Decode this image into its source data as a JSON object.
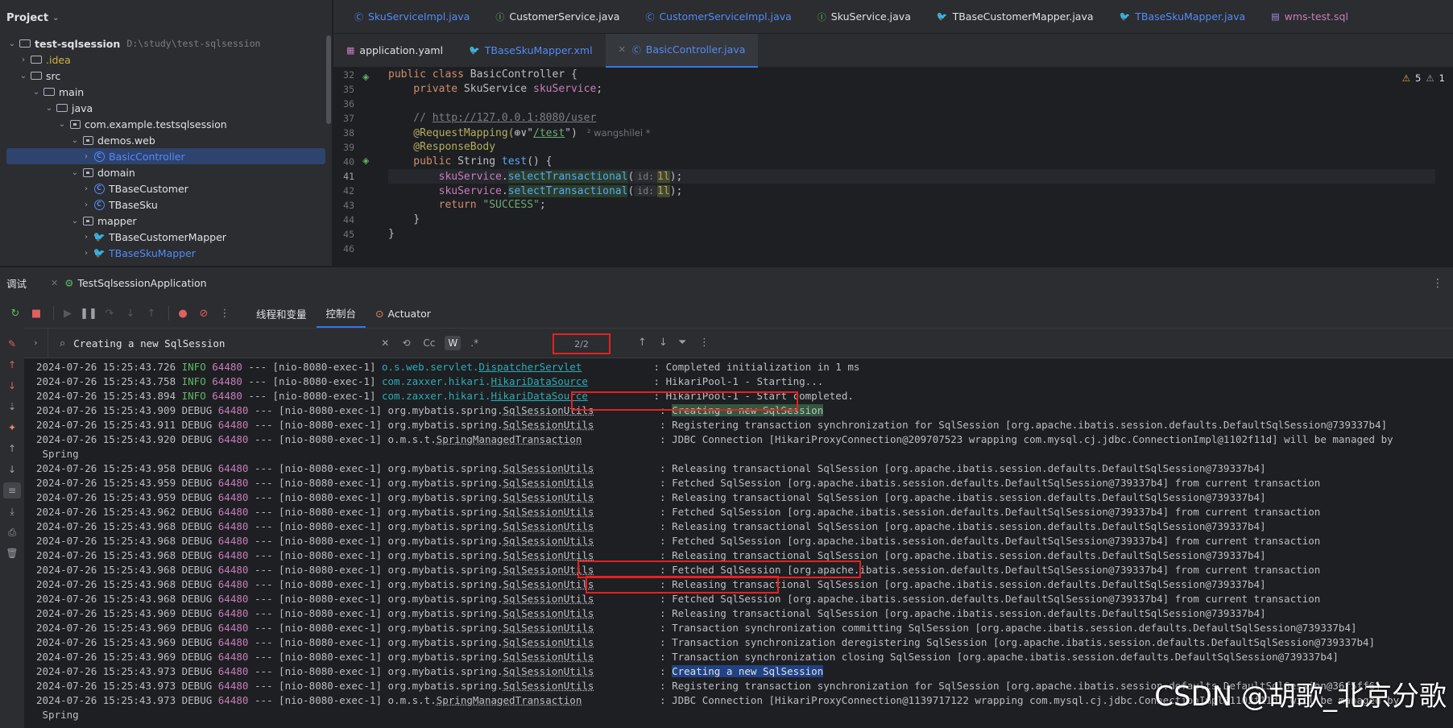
{
  "project": {
    "title": "Project",
    "tree": [
      {
        "label": "test-sqlsession",
        "path": "D:\\study\\test-sqlsession",
        "kind": "module"
      },
      {
        "label": ".idea",
        "kind": "folder"
      },
      {
        "label": "src",
        "kind": "folder"
      },
      {
        "label": "main",
        "kind": "folder"
      },
      {
        "label": "java",
        "kind": "folder"
      },
      {
        "label": "com.example.testsqlsession",
        "kind": "package"
      },
      {
        "label": "demos.web",
        "kind": "package"
      },
      {
        "label": "BasicController",
        "kind": "class"
      },
      {
        "label": "domain",
        "kind": "package"
      },
      {
        "label": "TBaseCustomer",
        "kind": "class"
      },
      {
        "label": "TBaseSku",
        "kind": "class"
      },
      {
        "label": "mapper",
        "kind": "package"
      },
      {
        "label": "TBaseCustomerMapper",
        "kind": "mapper"
      },
      {
        "label": "TBaseSkuMapper",
        "kind": "mapper"
      }
    ]
  },
  "editor": {
    "tabs_row1": [
      {
        "label": "SkuServiceImpl.java",
        "icon": "class-icon"
      },
      {
        "label": "CustomerService.java",
        "icon": "interface-icon"
      },
      {
        "label": "CustomerServiceImpl.java",
        "icon": "class-icon"
      },
      {
        "label": "SkuService.java",
        "icon": "interface-icon"
      },
      {
        "label": "TBaseCustomerMapper.java",
        "icon": "mapper-icon"
      },
      {
        "label": "TBaseSkuMapper.java",
        "icon": "mapper-icon"
      },
      {
        "label": "wms-test.sql",
        "icon": "sql-icon"
      }
    ],
    "tabs_row2": [
      {
        "label": "application.yaml",
        "icon": "yaml-icon"
      },
      {
        "label": "TBaseSkuMapper.xml",
        "icon": "xml-icon"
      },
      {
        "label": "BasicController.java",
        "icon": "class-icon",
        "active": true
      }
    ],
    "line_numbers": [
      "32",
      "35",
      "36",
      "37",
      "38",
      "39",
      "40",
      "41",
      "42",
      "43",
      "44",
      "45",
      "46"
    ],
    "code": {
      "l32_a": "public class ",
      "l32_b": "BasicController {",
      "l35_a": "    private ",
      "l35_b": "SkuService ",
      "l35_c": "skuService",
      "l37_a": "    // ",
      "l37_b": "http://127.0.0.1:8080/user",
      "l38_a": "    @RequestMapping(",
      "l38_b": "⊕∨\"",
      "l38_c": "/test",
      "l38_d": "\")",
      "l38_author": "² wangshilei *",
      "l39": "    @ResponseBody",
      "l40_a": "    public ",
      "l40_b": "String ",
      "l40_c": "test",
      "l40_d": "() {",
      "l41_a": "        skuService",
      "l41_b": ".",
      "l41_c": "selectTransactional",
      "l41_d": "(",
      "l41_hint": "id:",
      "l41_e": "1l",
      "l41_f": ");",
      "l42_a": "        skuService",
      "l42_b": ".",
      "l42_c": "selectTransactional",
      "l42_d": "(",
      "l42_hint": "id:",
      "l42_e": "1l",
      "l42_f": ");",
      "l43_a": "        return ",
      "l43_b": "\"SUCCESS\"",
      "l43_c": ";",
      "l44": "    }",
      "l45": "}"
    },
    "warnings": {
      "warn": "5",
      "weak": "1"
    }
  },
  "debug": {
    "title": "调试",
    "config": "TestSqlsessionApplication",
    "tabs": [
      "线程和变量",
      "控制台",
      "Actuator"
    ],
    "search": {
      "value": "Creating a new SqlSession",
      "case_label": "Cc",
      "word_label": "W",
      "regex_label": ".*",
      "count": "2/2"
    }
  },
  "console": {
    "lines": [
      {
        "ts": "2024-07-26 15:25:43.726",
        "lvl": " INFO",
        "pid": "64480",
        "thr": " --- [nio-8080-exec-1] ",
        "lgr_pre": "o.s.web.servlet.",
        "lgr_u": "DispatcherServlet",
        "lgr_post": "",
        "msg": " : Completed initialization in 1 ms",
        "type": "info"
      },
      {
        "ts": "2024-07-26 15:25:43.758",
        "lvl": " INFO",
        "pid": "64480",
        "thr": " --- [nio-8080-exec-1] ",
        "lgr_pre": "com.zaxxer.hikari.",
        "lgr_u": "HikariDataSource",
        "lgr_post": "",
        "msg": " : HikariPool-1 - Starting...",
        "type": "info"
      },
      {
        "ts": "2024-07-26 15:25:43.894",
        "lvl": " INFO",
        "pid": "64480",
        "thr": " --- [nio-8080-exec-1] ",
        "lgr_pre": "com.zaxxer.hikari.",
        "lgr_u": "HikariDataSource",
        "lgr_post": "",
        "msg": " : HikariPool-1 - Start completed.",
        "type": "info"
      },
      {
        "ts": "2024-07-26 15:25:43.909",
        "lvl": " DEBUG",
        "pid": "64480",
        "thr": " --- [nio-8080-exec-1] ",
        "lgr_pre": "org.mybatis.spring.",
        "lgr_u": "SqlSessionUtils",
        "lgr_post": "",
        "msg_pre": " : ",
        "msg_hl": "Creating a new SqlSession",
        "msg_post": "",
        "hl": "other",
        "type": "debug"
      },
      {
        "ts": "2024-07-26 15:25:43.911",
        "lvl": " DEBUG",
        "pid": "64480",
        "thr": " --- [nio-8080-exec-1] ",
        "lgr_pre": "org.mybatis.spring.",
        "lgr_u": "SqlSessionUtils",
        "lgr_post": "",
        "msg": " : Registering transaction synchronization for SqlSession [org.apache.ibatis.session.defaults.DefaultSqlSession@739337b4]",
        "type": "debug"
      },
      {
        "ts": "2024-07-26 15:25:43.920",
        "lvl": " DEBUG",
        "pid": "64480",
        "thr": " --- [nio-8080-exec-1] ",
        "lgr_pre": "o.m.s.t.",
        "lgr_u": "SpringManagedTransaction",
        "lgr_post": "",
        "msg": " : JDBC Connection [HikariProxyConnection@209707523 wrapping com.mysql.cj.jdbc.ConnectionImpl@1102f11d] will be managed by",
        "type": "debug"
      },
      {
        "cont": " Spring"
      },
      {
        "ts": "2024-07-26 15:25:43.958",
        "lvl": " DEBUG",
        "pid": "64480",
        "thr": " --- [nio-8080-exec-1] ",
        "lgr_pre": "org.mybatis.spring.",
        "lgr_u": "SqlSessionUtils",
        "lgr_post": "",
        "msg": " : Releasing transactional SqlSession [org.apache.ibatis.session.defaults.DefaultSqlSession@739337b4]",
        "type": "debug"
      },
      {
        "ts": "2024-07-26 15:25:43.959",
        "lvl": " DEBUG",
        "pid": "64480",
        "thr": " --- [nio-8080-exec-1] ",
        "lgr_pre": "org.mybatis.spring.",
        "lgr_u": "SqlSessionUtils",
        "lgr_post": "",
        "msg": " : Fetched SqlSession [org.apache.ibatis.session.defaults.DefaultSqlSession@739337b4] from current transaction",
        "type": "debug"
      },
      {
        "ts": "2024-07-26 15:25:43.959",
        "lvl": " DEBUG",
        "pid": "64480",
        "thr": " --- [nio-8080-exec-1] ",
        "lgr_pre": "org.mybatis.spring.",
        "lgr_u": "SqlSessionUtils",
        "lgr_post": "",
        "msg": " : Releasing transactional SqlSession [org.apache.ibatis.session.defaults.DefaultSqlSession@739337b4]",
        "type": "debug"
      },
      {
        "ts": "2024-07-26 15:25:43.962",
        "lvl": " DEBUG",
        "pid": "64480",
        "thr": " --- [nio-8080-exec-1] ",
        "lgr_pre": "org.mybatis.spring.",
        "lgr_u": "SqlSessionUtils",
        "lgr_post": "",
        "msg": " : Fetched SqlSession [org.apache.ibatis.session.defaults.DefaultSqlSession@739337b4] from current transaction",
        "type": "debug"
      },
      {
        "ts": "2024-07-26 15:25:43.968",
        "lvl": " DEBUG",
        "pid": "64480",
        "thr": " --- [nio-8080-exec-1] ",
        "lgr_pre": "org.mybatis.spring.",
        "lgr_u": "SqlSessionUtils",
        "lgr_post": "",
        "msg": " : Releasing transactional SqlSession [org.apache.ibatis.session.defaults.DefaultSqlSession@739337b4]",
        "type": "debug"
      },
      {
        "ts": "2024-07-26 15:25:43.968",
        "lvl": " DEBUG",
        "pid": "64480",
        "thr": " --- [nio-8080-exec-1] ",
        "lgr_pre": "org.mybatis.spring.",
        "lgr_u": "SqlSessionUtils",
        "lgr_post": "",
        "msg": " : Fetched SqlSession [org.apache.ibatis.session.defaults.DefaultSqlSession@739337b4] from current transaction",
        "type": "debug"
      },
      {
        "ts": "2024-07-26 15:25:43.968",
        "lvl": " DEBUG",
        "pid": "64480",
        "thr": " --- [nio-8080-exec-1] ",
        "lgr_pre": "org.mybatis.spring.",
        "lgr_u": "SqlSessionUtils",
        "lgr_post": "",
        "msg": " : Releasing transactional SqlSession [org.apache.ibatis.session.defaults.DefaultSqlSession@739337b4]",
        "type": "debug"
      },
      {
        "ts": "2024-07-26 15:25:43.968",
        "lvl": " DEBUG",
        "pid": "64480",
        "thr": " --- [nio-8080-exec-1] ",
        "lgr_pre": "org.mybatis.spring.",
        "lgr_u": "SqlSessionUtils",
        "lgr_post": "",
        "msg": " : Fetched SqlSession [org.apache.ibatis.session.defaults.DefaultSqlSession@739337b4] from current transaction",
        "type": "debug"
      },
      {
        "ts": "2024-07-26 15:25:43.968",
        "lvl": " DEBUG",
        "pid": "64480",
        "thr": " --- [nio-8080-exec-1] ",
        "lgr_pre": "org.mybatis.spring.",
        "lgr_u": "SqlSessionUtils",
        "lgr_post": "",
        "msg": " : Releasing transactional SqlSession [org.apache.ibatis.session.defaults.DefaultSqlSession@739337b4]",
        "type": "debug"
      },
      {
        "ts": "2024-07-26 15:25:43.968",
        "lvl": " DEBUG",
        "pid": "64480",
        "thr": " --- [nio-8080-exec-1] ",
        "lgr_pre": "org.mybatis.spring.",
        "lgr_u": "SqlSessionUtils",
        "lgr_post": "",
        "msg": " : Fetched SqlSession [org.apache.ibatis.session.defaults.DefaultSqlSession@739337b4] from current transaction",
        "type": "debug"
      },
      {
        "ts": "2024-07-26 15:25:43.969",
        "lvl": " DEBUG",
        "pid": "64480",
        "thr": " --- [nio-8080-exec-1] ",
        "lgr_pre": "org.mybatis.spring.",
        "lgr_u": "SqlSessionUtils",
        "lgr_post": "",
        "msg": " : Releasing transactional SqlSession [org.apache.ibatis.session.defaults.DefaultSqlSession@739337b4]",
        "type": "debug"
      },
      {
        "ts": "2024-07-26 15:25:43.969",
        "lvl": " DEBUG",
        "pid": "64480",
        "thr": " --- [nio-8080-exec-1] ",
        "lgr_pre": "org.mybatis.spring.",
        "lgr_u": "SqlSessionUtils",
        "lgr_post": "",
        "msg": " : Transaction synchronization committing SqlSession [org.apache.ibatis.session.defaults.DefaultSqlSession@739337b4]",
        "type": "debug"
      },
      {
        "ts": "2024-07-26 15:25:43.969",
        "lvl": " DEBUG",
        "pid": "64480",
        "thr": " --- [nio-8080-exec-1] ",
        "lgr_pre": "org.mybatis.spring.",
        "lgr_u": "SqlSessionUtils",
        "lgr_post": "",
        "msg": " : Transaction synchronization deregistering SqlSession [org.apache.ibatis.session.defaults.DefaultSqlSession@739337b4]",
        "type": "debug"
      },
      {
        "ts": "2024-07-26 15:25:43.969",
        "lvl": " DEBUG",
        "pid": "64480",
        "thr": " --- [nio-8080-exec-1] ",
        "lgr_pre": "org.mybatis.spring.",
        "lgr_u": "SqlSessionUtils",
        "lgr_post": "",
        "msg": " : Transaction synchronization closing SqlSession [org.apache.ibatis.session.defaults.DefaultSqlSession@739337b4]",
        "type": "debug"
      },
      {
        "ts": "2024-07-26 15:25:43.973",
        "lvl": " DEBUG",
        "pid": "64480",
        "thr": " --- [nio-8080-exec-1] ",
        "lgr_pre": "org.mybatis.spring.",
        "lgr_u": "SqlSessionUtils",
        "lgr_post": "",
        "msg_pre": " : ",
        "msg_hl": "Creating a new SqlSession",
        "msg_post": "",
        "hl": "current",
        "type": "debug"
      },
      {
        "ts": "2024-07-26 15:25:43.973",
        "lvl": " DEBUG",
        "pid": "64480",
        "thr": " --- [nio-8080-exec-1] ",
        "lgr_pre": "org.mybatis.spring.",
        "lgr_u": "SqlSessionUtils",
        "lgr_post": "",
        "msg": " : Registering transaction synchronization for SqlSession [org.apache.ibatis.session.defaults.DefaultSqlSession@36f5ff6]",
        "type": "debug"
      },
      {
        "ts": "2024-07-26 15:25:43.973",
        "lvl": " DEBUG",
        "pid": "64480",
        "thr": " --- [nio-8080-exec-1] ",
        "lgr_pre": "o.m.s.t.",
        "lgr_u": "SpringManagedTransaction",
        "lgr_post": "",
        "msg": " : JDBC Connection [HikariProxyConnection@1139717122 wrapping com.mysql.cj.jdbc.ConnectionImpl@1102f11d] will be managed by",
        "type": "debug"
      },
      {
        "cont": " Spring"
      }
    ]
  },
  "watermark": "CSDN @胡歌_北京分歌",
  "colors": {
    "accent": "#3574f0",
    "highlight_box": "#e82020",
    "match_current": "#214283",
    "match_other": "#32593d"
  }
}
